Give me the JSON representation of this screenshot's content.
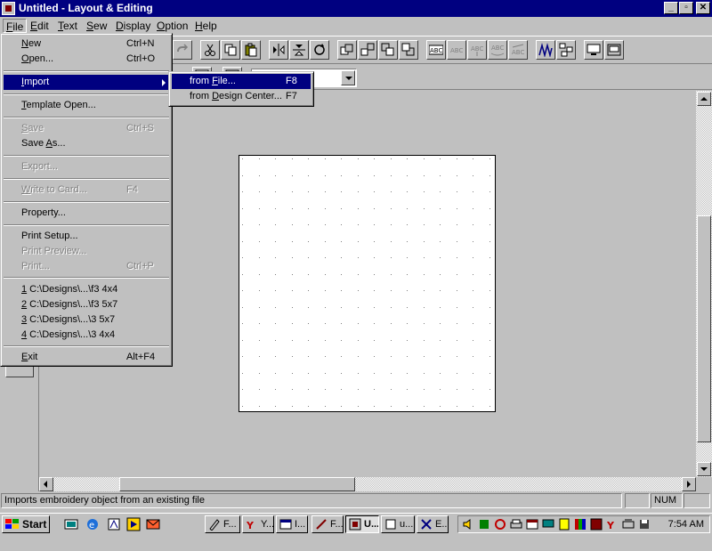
{
  "window": {
    "title": "Untitled - Layout & Editing",
    "controls": [
      "_",
      "▫",
      "✕"
    ]
  },
  "menubar": [
    {
      "label": "File",
      "key": "F",
      "rest": "ile"
    },
    {
      "label": "Edit",
      "key": "E",
      "rest": "dit"
    },
    {
      "label": "Text",
      "key": "T",
      "rest": "ext"
    },
    {
      "label": "Sew",
      "key": "S",
      "rest": "ew"
    },
    {
      "label": "Display",
      "key": "D",
      "rest": "isplay"
    },
    {
      "label": "Option",
      "key": "O",
      "rest": "ption"
    },
    {
      "label": "Help",
      "key": "H",
      "rest": "elp"
    }
  ],
  "file_menu": {
    "new": {
      "key": "N",
      "rest": "ew",
      "shortcut": "Ctrl+N"
    },
    "open": {
      "key": "O",
      "rest": "pen...",
      "shortcut": "Ctrl+O"
    },
    "import": {
      "key": "I",
      "rest": "mport"
    },
    "template_open": {
      "key": "T",
      "rest": "emplate Open..."
    },
    "save": {
      "key": "S",
      "rest": "ave",
      "shortcut": "Ctrl+S"
    },
    "save_as": {
      "pre": "Save ",
      "key": "A",
      "rest": "s..."
    },
    "export": {
      "pre": "Export..."
    },
    "write_to_card": {
      "key": "W",
      "rest": "rite to Card...",
      "shortcut": "F4"
    },
    "property": {
      "pre": "Property..."
    },
    "print_setup": {
      "pre": "Print Setup..."
    },
    "print_preview": {
      "pre": "Print Preview..."
    },
    "print": {
      "pre": "Print...",
      "shortcut": "Ctrl+P"
    },
    "recent": [
      {
        "key": "1",
        "rest": " C:\\Designs\\...\\f3 4x4"
      },
      {
        "key": "2",
        "rest": " C:\\Designs\\...\\f3 5x7"
      },
      {
        "key": "3",
        "rest": " C:\\Designs\\...\\3 5x7"
      },
      {
        "key": "4",
        "rest": " C:\\Designs\\...\\3 4x4"
      }
    ],
    "exit": {
      "key": "E",
      "rest": "xit",
      "shortcut": "Alt+F4"
    }
  },
  "import_submenu": {
    "from_file": {
      "pre": "from ",
      "key": "F",
      "rest": "ile...",
      "shortcut": "F8"
    },
    "from_design_center": {
      "pre": "from ",
      "key": "D",
      "rest": "esign Center...",
      "shortcut": "F7"
    }
  },
  "statusbar": {
    "message": "Imports embroidery object from an existing file",
    "indicator": "NUM"
  },
  "taskbar": {
    "start_label": "Start",
    "tasks": [
      {
        "label": "F..."
      },
      {
        "label": "Y..."
      },
      {
        "label": "I..."
      },
      {
        "label": "F..."
      },
      {
        "label": "U...",
        "active": true
      },
      {
        "label": "u..."
      },
      {
        "label": "E..."
      }
    ],
    "clock": "7:54 AM"
  },
  "colors": {
    "titlebar": "#000080",
    "menu_highlight": "#000080",
    "face": "#c0c0c0"
  }
}
